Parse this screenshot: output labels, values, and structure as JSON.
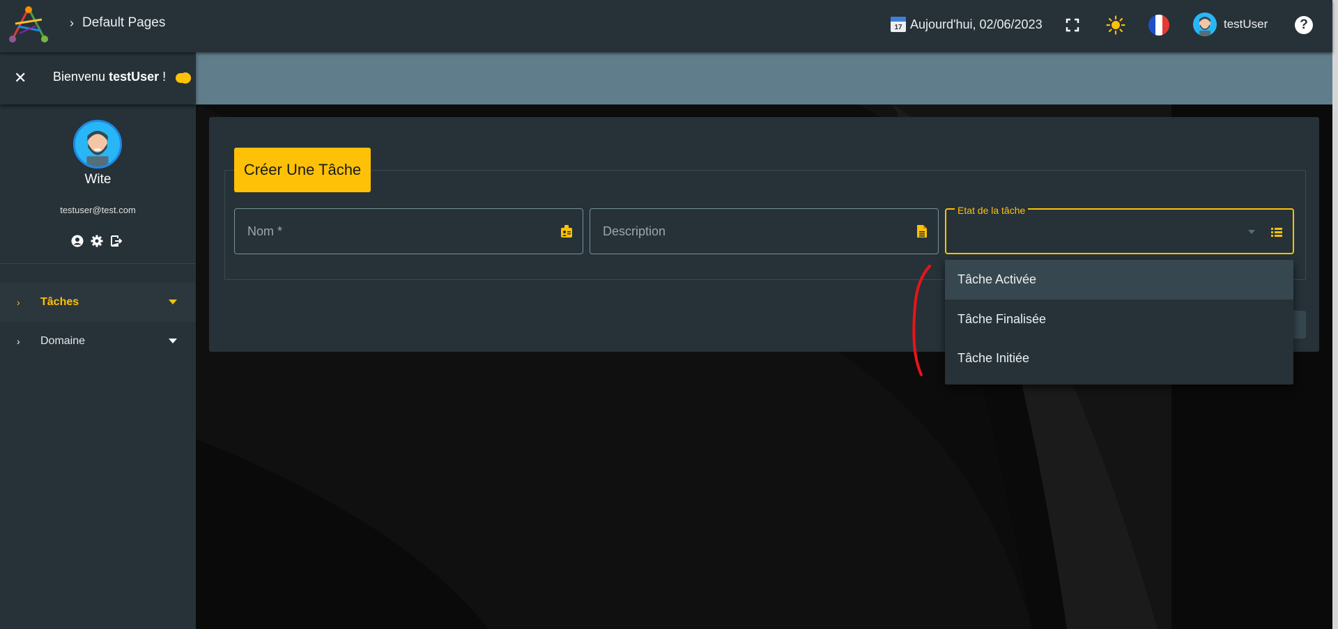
{
  "header": {
    "breadcrumb": "Default Pages",
    "date_label": "Aujourd'hui, 02/06/2023",
    "calendar_day": "17",
    "username": "testUser",
    "help_glyph": "?"
  },
  "sidebar": {
    "welcome_prefix": "Bienvenu",
    "welcome_user": "testUser",
    "welcome_suffix": "!",
    "profile_name": "Wite",
    "profile_email": "testuser@test.com",
    "menu": [
      {
        "label": "Tâches",
        "active": true
      },
      {
        "label": "Domaine",
        "active": false
      }
    ]
  },
  "form": {
    "title": "Créer Une Tâche",
    "name_placeholder": "Nom *",
    "description_placeholder": "Description",
    "state_label": "Etat de la tâche",
    "state_options": [
      "Tâche Activée",
      "Tâche Finalisée",
      "Tâche Initiée"
    ]
  },
  "colors": {
    "accent": "#ffc107",
    "topbar": "#263238",
    "band": "#607d8b",
    "annotation": "#e8141b"
  }
}
